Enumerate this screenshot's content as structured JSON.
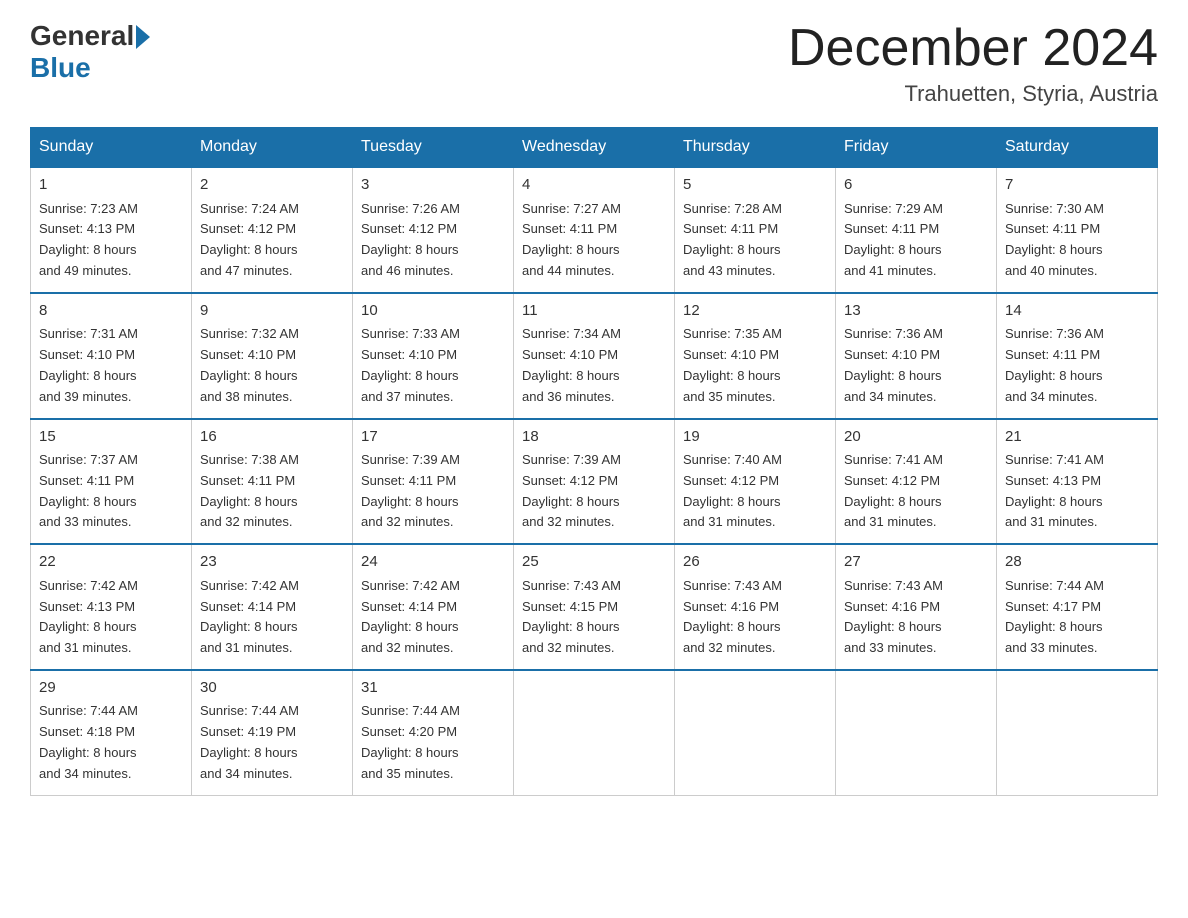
{
  "logo": {
    "general": "General",
    "blue": "Blue"
  },
  "header": {
    "month_year": "December 2024",
    "location": "Trahuetten, Styria, Austria"
  },
  "days_of_week": [
    "Sunday",
    "Monday",
    "Tuesday",
    "Wednesday",
    "Thursday",
    "Friday",
    "Saturday"
  ],
  "weeks": [
    [
      {
        "day": "1",
        "sunrise": "7:23 AM",
        "sunset": "4:13 PM",
        "daylight": "8 hours and 49 minutes."
      },
      {
        "day": "2",
        "sunrise": "7:24 AM",
        "sunset": "4:12 PM",
        "daylight": "8 hours and 47 minutes."
      },
      {
        "day": "3",
        "sunrise": "7:26 AM",
        "sunset": "4:12 PM",
        "daylight": "8 hours and 46 minutes."
      },
      {
        "day": "4",
        "sunrise": "7:27 AM",
        "sunset": "4:11 PM",
        "daylight": "8 hours and 44 minutes."
      },
      {
        "day": "5",
        "sunrise": "7:28 AM",
        "sunset": "4:11 PM",
        "daylight": "8 hours and 43 minutes."
      },
      {
        "day": "6",
        "sunrise": "7:29 AM",
        "sunset": "4:11 PM",
        "daylight": "8 hours and 41 minutes."
      },
      {
        "day": "7",
        "sunrise": "7:30 AM",
        "sunset": "4:11 PM",
        "daylight": "8 hours and 40 minutes."
      }
    ],
    [
      {
        "day": "8",
        "sunrise": "7:31 AM",
        "sunset": "4:10 PM",
        "daylight": "8 hours and 39 minutes."
      },
      {
        "day": "9",
        "sunrise": "7:32 AM",
        "sunset": "4:10 PM",
        "daylight": "8 hours and 38 minutes."
      },
      {
        "day": "10",
        "sunrise": "7:33 AM",
        "sunset": "4:10 PM",
        "daylight": "8 hours and 37 minutes."
      },
      {
        "day": "11",
        "sunrise": "7:34 AM",
        "sunset": "4:10 PM",
        "daylight": "8 hours and 36 minutes."
      },
      {
        "day": "12",
        "sunrise": "7:35 AM",
        "sunset": "4:10 PM",
        "daylight": "8 hours and 35 minutes."
      },
      {
        "day": "13",
        "sunrise": "7:36 AM",
        "sunset": "4:10 PM",
        "daylight": "8 hours and 34 minutes."
      },
      {
        "day": "14",
        "sunrise": "7:36 AM",
        "sunset": "4:11 PM",
        "daylight": "8 hours and 34 minutes."
      }
    ],
    [
      {
        "day": "15",
        "sunrise": "7:37 AM",
        "sunset": "4:11 PM",
        "daylight": "8 hours and 33 minutes."
      },
      {
        "day": "16",
        "sunrise": "7:38 AM",
        "sunset": "4:11 PM",
        "daylight": "8 hours and 32 minutes."
      },
      {
        "day": "17",
        "sunrise": "7:39 AM",
        "sunset": "4:11 PM",
        "daylight": "8 hours and 32 minutes."
      },
      {
        "day": "18",
        "sunrise": "7:39 AM",
        "sunset": "4:12 PM",
        "daylight": "8 hours and 32 minutes."
      },
      {
        "day": "19",
        "sunrise": "7:40 AM",
        "sunset": "4:12 PM",
        "daylight": "8 hours and 31 minutes."
      },
      {
        "day": "20",
        "sunrise": "7:41 AM",
        "sunset": "4:12 PM",
        "daylight": "8 hours and 31 minutes."
      },
      {
        "day": "21",
        "sunrise": "7:41 AM",
        "sunset": "4:13 PM",
        "daylight": "8 hours and 31 minutes."
      }
    ],
    [
      {
        "day": "22",
        "sunrise": "7:42 AM",
        "sunset": "4:13 PM",
        "daylight": "8 hours and 31 minutes."
      },
      {
        "day": "23",
        "sunrise": "7:42 AM",
        "sunset": "4:14 PM",
        "daylight": "8 hours and 31 minutes."
      },
      {
        "day": "24",
        "sunrise": "7:42 AM",
        "sunset": "4:14 PM",
        "daylight": "8 hours and 32 minutes."
      },
      {
        "day": "25",
        "sunrise": "7:43 AM",
        "sunset": "4:15 PM",
        "daylight": "8 hours and 32 minutes."
      },
      {
        "day": "26",
        "sunrise": "7:43 AM",
        "sunset": "4:16 PM",
        "daylight": "8 hours and 32 minutes."
      },
      {
        "day": "27",
        "sunrise": "7:43 AM",
        "sunset": "4:16 PM",
        "daylight": "8 hours and 33 minutes."
      },
      {
        "day": "28",
        "sunrise": "7:44 AM",
        "sunset": "4:17 PM",
        "daylight": "8 hours and 33 minutes."
      }
    ],
    [
      {
        "day": "29",
        "sunrise": "7:44 AM",
        "sunset": "4:18 PM",
        "daylight": "8 hours and 34 minutes."
      },
      {
        "day": "30",
        "sunrise": "7:44 AM",
        "sunset": "4:19 PM",
        "daylight": "8 hours and 34 minutes."
      },
      {
        "day": "31",
        "sunrise": "7:44 AM",
        "sunset": "4:20 PM",
        "daylight": "8 hours and 35 minutes."
      },
      null,
      null,
      null,
      null
    ]
  ],
  "labels": {
    "sunrise": "Sunrise: ",
    "sunset": "Sunset: ",
    "daylight": "Daylight: "
  }
}
